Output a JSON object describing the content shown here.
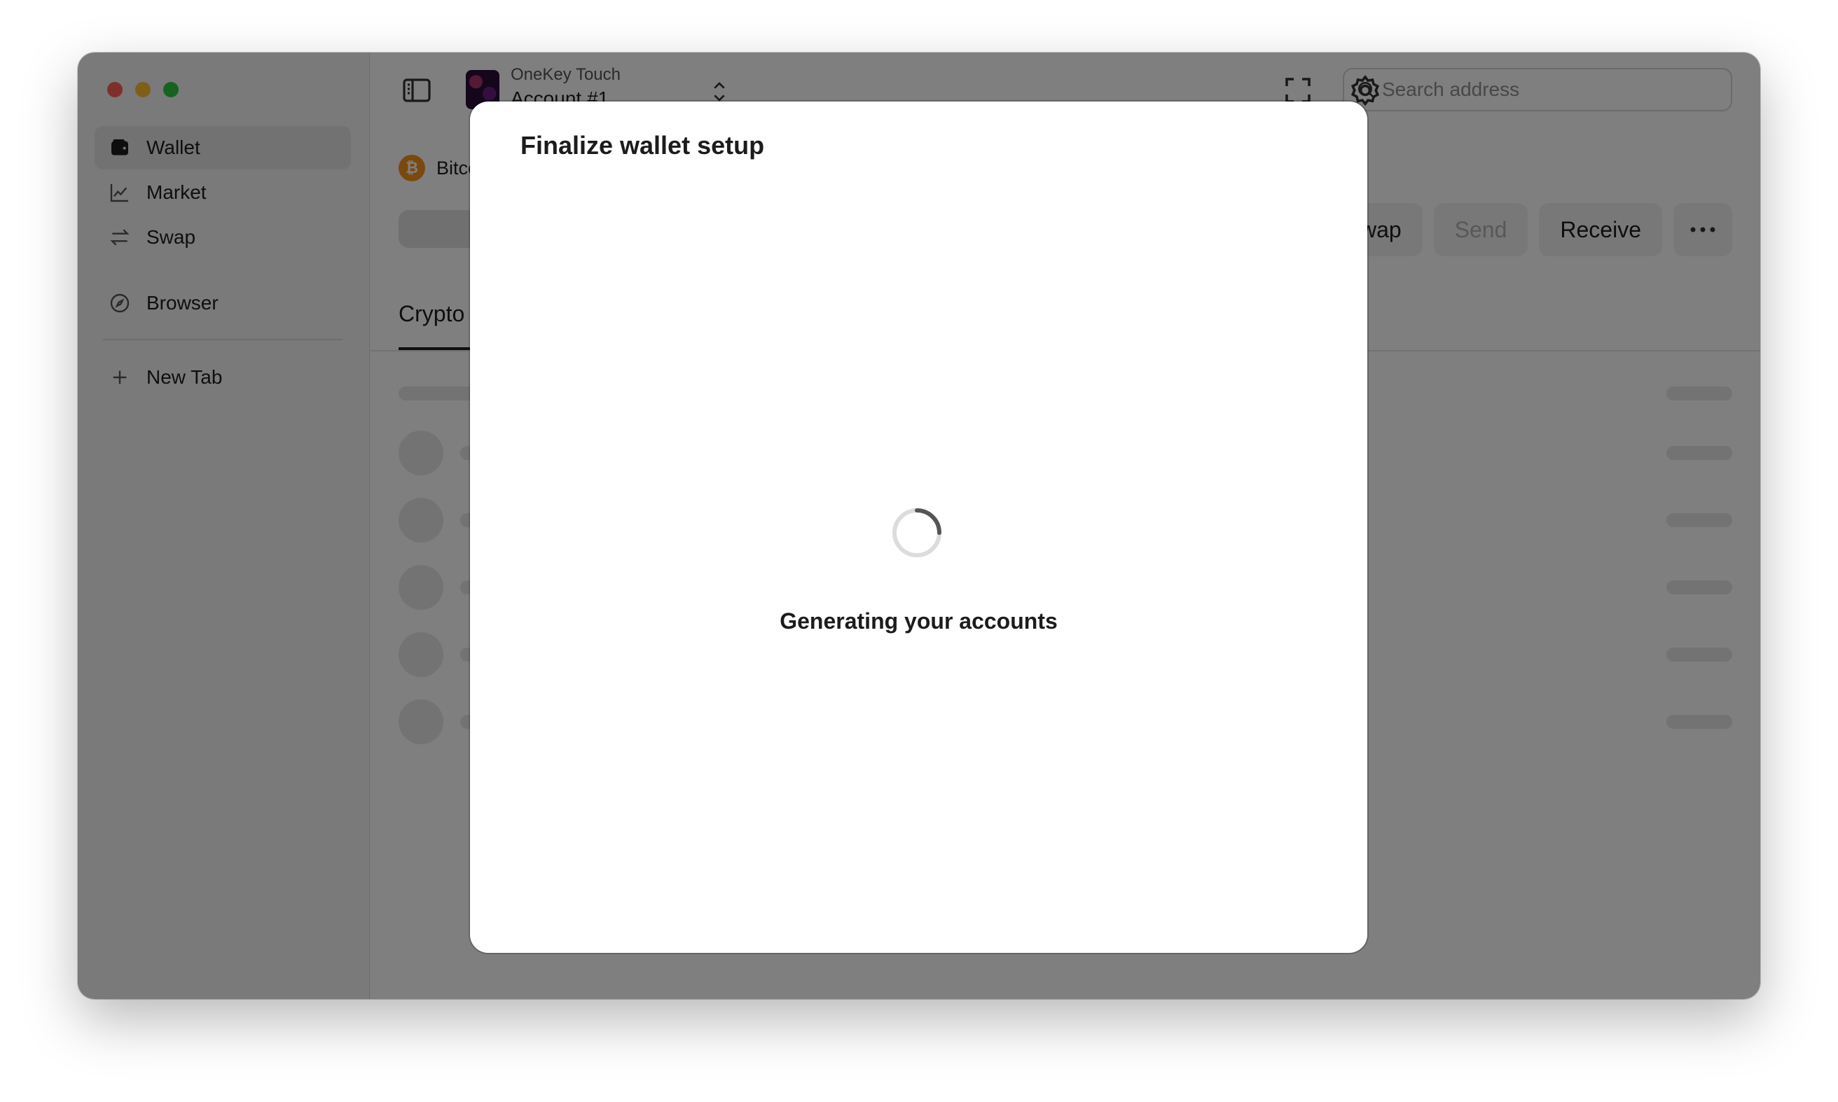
{
  "sidebar": {
    "items": [
      {
        "label": "Wallet",
        "icon": "wallet-icon"
      },
      {
        "label": "Market",
        "icon": "chart-icon"
      },
      {
        "label": "Swap",
        "icon": "swap-icon"
      },
      {
        "label": "Browser",
        "icon": "compass-icon"
      },
      {
        "label": "New Tab",
        "icon": "plus-icon"
      }
    ]
  },
  "header": {
    "wallet_name": "OneKey Touch",
    "account_name": "Account #1",
    "search_placeholder": "Search address"
  },
  "main": {
    "chain_label": "Bitcoin",
    "actions": {
      "swap": "Swap",
      "send": "Send",
      "receive": "Receive"
    },
    "tab_crypto": "Crypto"
  },
  "dialog": {
    "title": "Finalize wallet setup",
    "message": "Generating your accounts"
  },
  "colors": {
    "overlay": "#000000",
    "accent_btc": "#f7931a"
  }
}
